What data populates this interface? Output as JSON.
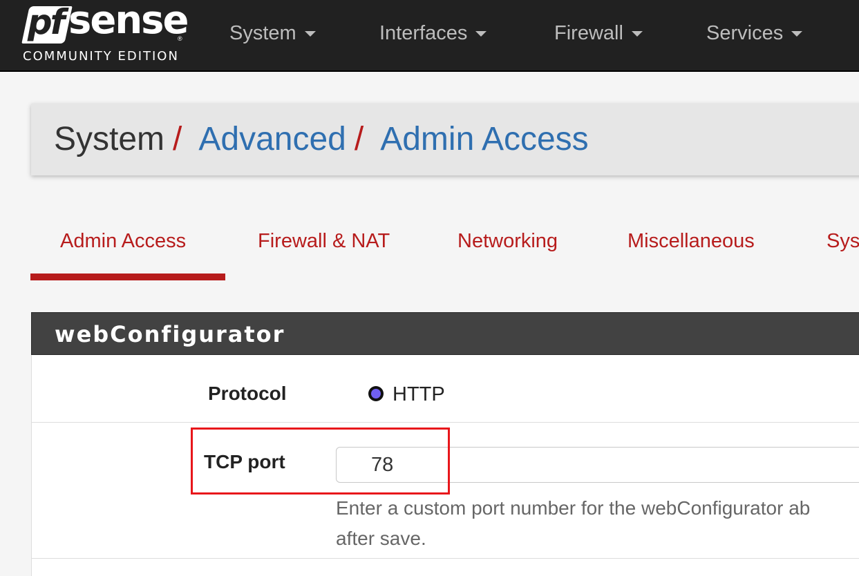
{
  "brand": {
    "logo_pf": "pf",
    "logo_sense": "sense",
    "logo_reg": "®",
    "edition": "COMMUNITY EDITION"
  },
  "nav": {
    "items": [
      {
        "label": "System"
      },
      {
        "label": "Interfaces"
      },
      {
        "label": "Firewall"
      },
      {
        "label": "Services"
      }
    ]
  },
  "breadcrumb": {
    "root": "System",
    "separator": "/",
    "section": "Advanced",
    "page": "Admin Access"
  },
  "tabs": [
    {
      "label": "Admin Access",
      "active": true
    },
    {
      "label": "Firewall & NAT",
      "active": false
    },
    {
      "label": "Networking",
      "active": false
    },
    {
      "label": "Miscellaneous",
      "active": false
    },
    {
      "label": "Sys",
      "active": false
    }
  ],
  "panel": {
    "title": "webConfigurator",
    "protocol": {
      "label": "Protocol",
      "option": "HTTP",
      "selected": true
    },
    "tcp_port": {
      "label": "TCP port",
      "value": "78",
      "help": "Enter a custom port number for the webConfigurator ab",
      "help_line2": "after save."
    }
  },
  "colors": {
    "navbar": "#212121",
    "accent_red": "#b71c1c",
    "link_blue": "#2f6fb0",
    "panel_heading": "#424242",
    "highlight": "#e8161b"
  }
}
